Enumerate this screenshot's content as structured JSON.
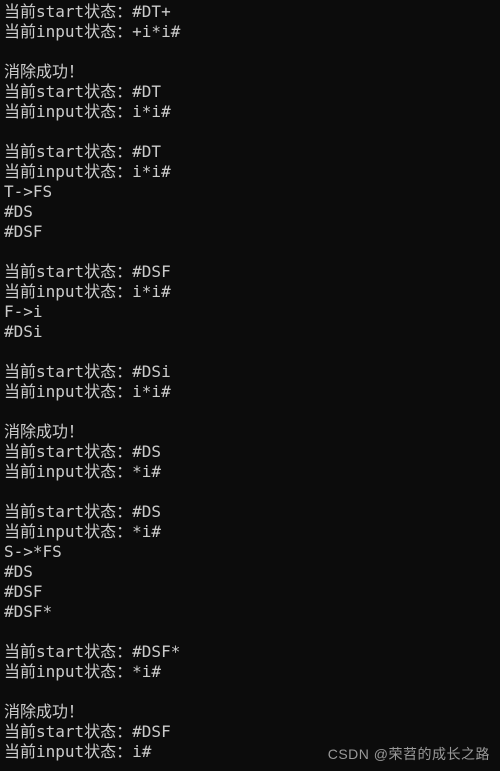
{
  "terminal": {
    "lines": [
      "当前start状态：#DT+",
      "当前input状态：+i*i#",
      "",
      "消除成功！",
      "当前start状态：#DT",
      "当前input状态：i*i#",
      "",
      "当前start状态：#DT",
      "当前input状态：i*i#",
      "T->FS",
      "#DS",
      "#DSF",
      "",
      "当前start状态：#DSF",
      "当前input状态：i*i#",
      "F->i",
      "#DSi",
      "",
      "当前start状态：#DSi",
      "当前input状态：i*i#",
      "",
      "消除成功！",
      "当前start状态：#DS",
      "当前input状态：*i#",
      "",
      "当前start状态：#DS",
      "当前input状态：*i#",
      "S->*FS",
      "#DS",
      "#DSF",
      "#DSF*",
      "",
      "当前start状态：#DSF*",
      "当前input状态：*i#",
      "",
      "消除成功！",
      "当前start状态：#DSF",
      "当前input状态：i#"
    ]
  },
  "watermark": {
    "text": "CSDN @荣苕的成长之路"
  }
}
